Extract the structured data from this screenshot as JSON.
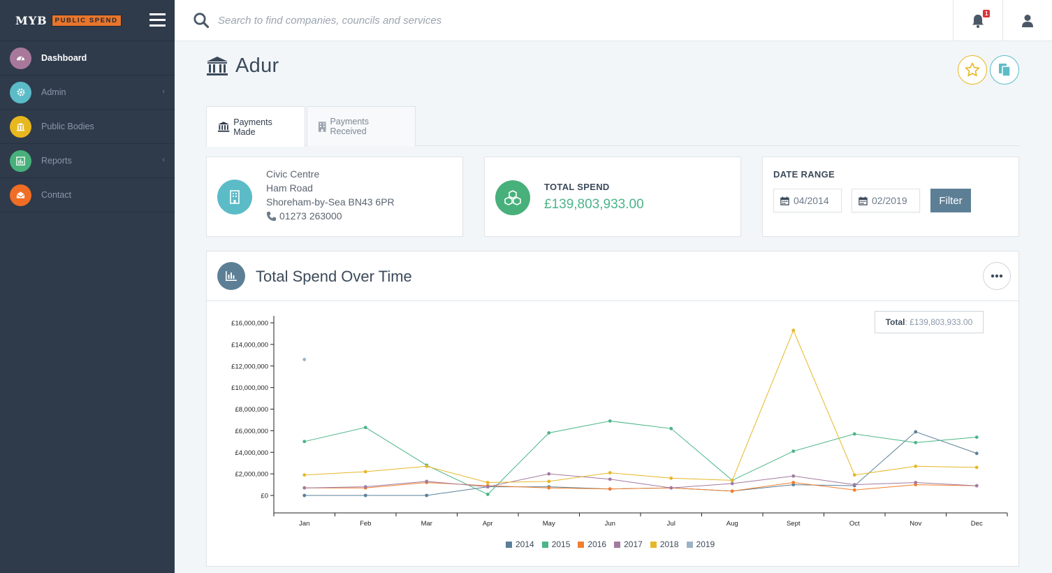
{
  "brand": {
    "name": "MYB",
    "tag": "PUBLIC SPEND"
  },
  "sidebar": {
    "items": [
      {
        "label": "Dashboard",
        "icon": "dashboard-icon",
        "color": "#a8789b",
        "active": true,
        "chevron": false
      },
      {
        "label": "Admin",
        "icon": "gear-icon",
        "color": "#5bbcc7",
        "active": false,
        "chevron": true
      },
      {
        "label": "Public Bodies",
        "icon": "bank-icon",
        "color": "#e7b71f",
        "active": false,
        "chevron": false
      },
      {
        "label": "Reports",
        "icon": "bar-chart-icon",
        "color": "#48b07b",
        "active": false,
        "chevron": true
      },
      {
        "label": "Contact",
        "icon": "envelope-icon",
        "color": "#f06d25",
        "active": false,
        "chevron": false
      }
    ]
  },
  "search": {
    "placeholder": "Search to find companies, councils and services"
  },
  "notifications": {
    "count": "1"
  },
  "page": {
    "title": "Adur"
  },
  "tabs": [
    {
      "label": "Payments Made",
      "icon": "bank-icon",
      "active": true
    },
    {
      "label": "Payments Received",
      "icon": "building-icon",
      "active": false
    }
  ],
  "address": {
    "line1": "Civic Centre",
    "line2": "Ham Road",
    "line3": "Shoreham-by-Sea BN43 6PR",
    "phone": "01273 263000"
  },
  "total_spend": {
    "label": "TOTAL SPEND",
    "value": "£139,803,933.00"
  },
  "date_range": {
    "label": "DATE RANGE",
    "from": "04/2014",
    "to": "02/2019",
    "filter_label": "Filter"
  },
  "chart_card": {
    "title": "Total Spend Over Time",
    "total_label": "Total",
    "total_value": "£139,803,933.00"
  },
  "colors": {
    "accent_star": "#e7b71f",
    "accent_copy": "#5bbcc7",
    "total_spend": "#4ab587",
    "filter_button": "#5c7f96"
  },
  "chart_data": {
    "type": "line",
    "title": "",
    "xlabel": "",
    "ylabel": "",
    "categories": [
      "Jan",
      "Feb",
      "Mar",
      "Apr",
      "May",
      "Jun",
      "Jul",
      "Aug",
      "Sept",
      "Oct",
      "Nov",
      "Dec"
    ],
    "ylim": [
      0,
      16000000
    ],
    "yticks": [
      "£0",
      "£2,000,000",
      "£4,000,000",
      "£6,000,000",
      "£8,000,000",
      "£10,000,000",
      "£12,000,000",
      "£14,000,000",
      "£16,000,000"
    ],
    "grid": false,
    "legend": "bottom",
    "series": [
      {
        "name": "2014",
        "color": "#5a7f97",
        "values": [
          0,
          0,
          0,
          800000,
          800000,
          600000,
          700000,
          400000,
          1000000,
          900000,
          5900000,
          3900000
        ]
      },
      {
        "name": "2015",
        "color": "#4ab587",
        "values": [
          5000000,
          6300000,
          2800000,
          100000,
          5800000,
          6900000,
          6200000,
          1400000,
          4100000,
          5700000,
          4900000,
          5400000
        ]
      },
      {
        "name": "2016",
        "color": "#f07f2e",
        "values": [
          700000,
          700000,
          1200000,
          900000,
          700000,
          600000,
          700000,
          400000,
          1200000,
          500000,
          1000000,
          900000
        ]
      },
      {
        "name": "2017",
        "color": "#a27aa0",
        "values": [
          700000,
          800000,
          1300000,
          800000,
          2000000,
          1500000,
          700000,
          1100000,
          1800000,
          1000000,
          1200000,
          900000
        ]
      },
      {
        "name": "2018",
        "color": "#e6b728",
        "values": [
          1900000,
          2200000,
          2700000,
          1200000,
          1300000,
          2100000,
          1600000,
          1400000,
          15300000,
          1900000,
          2700000,
          2600000
        ]
      },
      {
        "name": "2019",
        "color": "#9cb2c5",
        "values": [
          12600000,
          null,
          null,
          null,
          null,
          null,
          null,
          null,
          null,
          null,
          null,
          null
        ]
      }
    ]
  }
}
